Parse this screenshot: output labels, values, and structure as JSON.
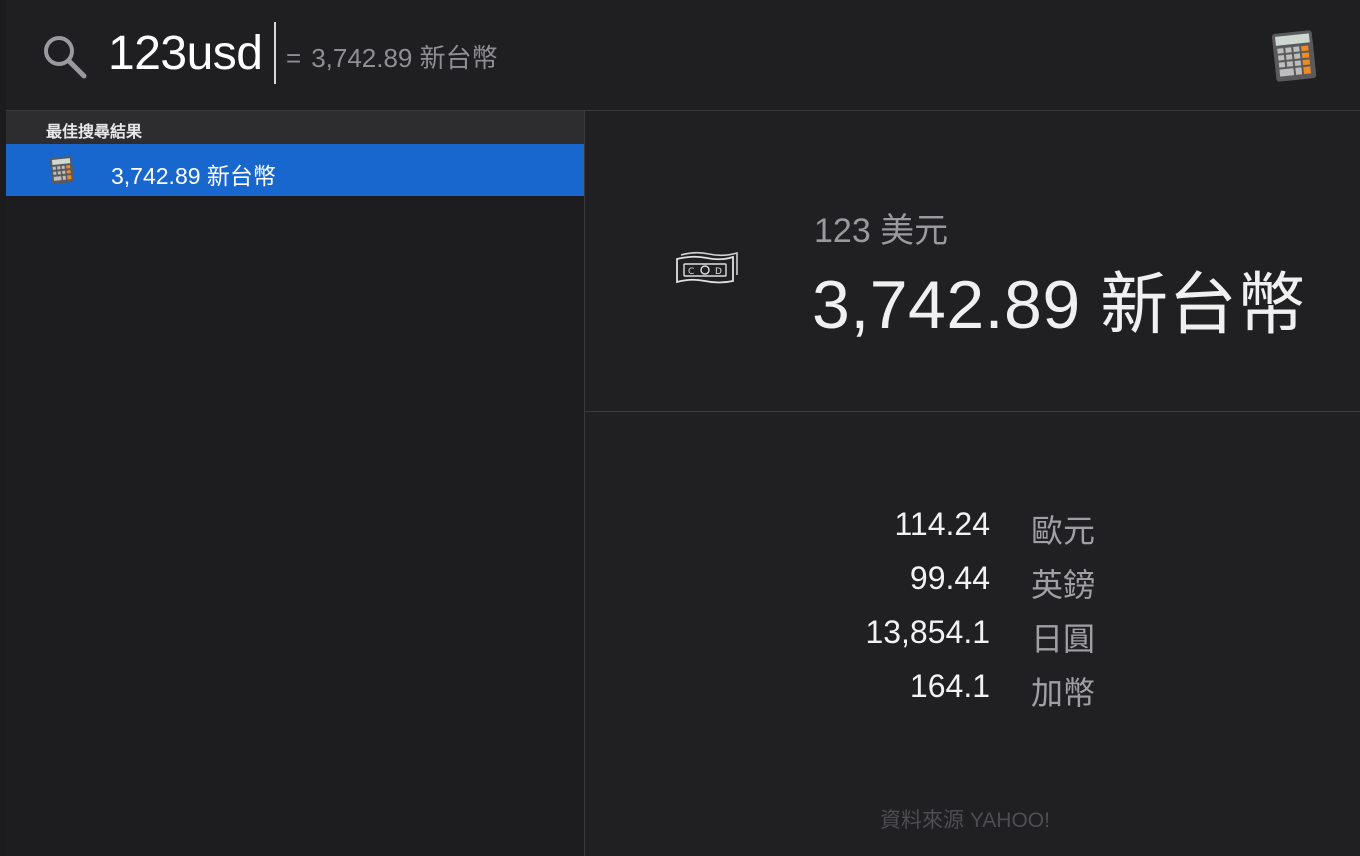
{
  "search": {
    "query": "123usd",
    "inline_equals": "=",
    "inline_result": "3,742.89 新台幣"
  },
  "results": {
    "section_header": "最佳搜尋結果",
    "top_hit_label": "3,742.89 新台幣"
  },
  "preview": {
    "source_amount": "123 美元",
    "converted_amount": "3,742.89 新台幣",
    "rates": [
      {
        "value": "114.24",
        "currency": "歐元"
      },
      {
        "value": "99.44",
        "currency": "英鎊"
      },
      {
        "value": "13,854.1",
        "currency": "日圓"
      },
      {
        "value": "164.1",
        "currency": "加幣"
      }
    ],
    "source_credit": "資料來源 YAHOO!"
  },
  "icons": {
    "search": "search-icon",
    "calculator": "calculator-icon",
    "money": "money-bills-icon"
  },
  "colors": {
    "selection": "#1867cf",
    "background": "#202022"
  }
}
